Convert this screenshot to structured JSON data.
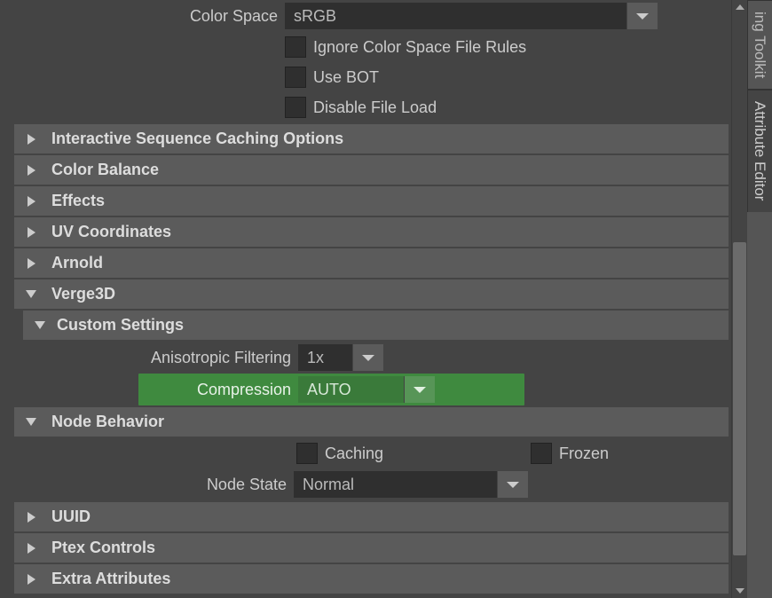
{
  "tabs": {
    "modeling_toolkit": "ing Toolkit",
    "attribute_editor": "Attribute Editor"
  },
  "color_space": {
    "label": "Color Space",
    "value": "sRGB"
  },
  "checkboxes": {
    "ignore_color_space": "Ignore Color Space File Rules",
    "use_bot": "Use BOT",
    "disable_file_load": "Disable File Load"
  },
  "sections": {
    "interactive_sequence": "Interactive Sequence Caching Options",
    "color_balance": "Color Balance",
    "effects": "Effects",
    "uv_coordinates": "UV Coordinates",
    "arnold": "Arnold",
    "verge3d": "Verge3D",
    "custom_settings": "Custom Settings",
    "node_behavior": "Node Behavior",
    "uuid": "UUID",
    "ptex_controls": "Ptex Controls",
    "extra_attributes": "Extra Attributes"
  },
  "aniso": {
    "label": "Anisotropic Filtering",
    "value": "1x"
  },
  "compression": {
    "label": "Compression",
    "value": "AUTO"
  },
  "node_behavior": {
    "caching": "Caching",
    "frozen": "Frozen",
    "state_label": "Node State",
    "state_value": "Normal"
  }
}
